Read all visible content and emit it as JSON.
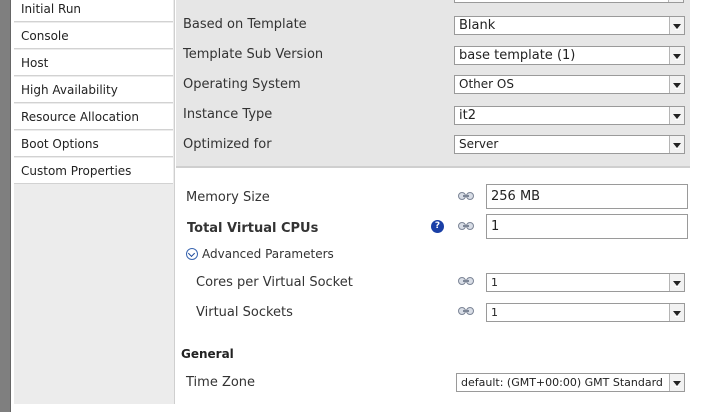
{
  "sidebar": {
    "items": [
      {
        "label": "Initial Run"
      },
      {
        "label": "Console"
      },
      {
        "label": "Host"
      },
      {
        "label": "High Availability"
      },
      {
        "label": "Resource Allocation"
      },
      {
        "label": "Boot Options"
      },
      {
        "label": "Custom Properties"
      }
    ]
  },
  "top_section": {
    "based_on_template": {
      "label": "Based on Template",
      "value": "Blank"
    },
    "template_sub_version": {
      "label": "Template Sub Version",
      "value": "base template (1)"
    },
    "operating_system": {
      "label": "Operating System",
      "value": "Other OS"
    },
    "instance_type": {
      "label": "Instance Type",
      "value": "it2"
    },
    "optimized_for": {
      "label": "Optimized for",
      "value": "Server"
    }
  },
  "system": {
    "memory_size": {
      "label": "Memory Size",
      "value": "256 MB"
    },
    "total_virtual_cpus": {
      "label": "Total Virtual CPUs",
      "value": "1"
    },
    "advanced_parameters": {
      "label": "Advanced Parameters"
    },
    "cores_per_virtual_socket": {
      "label": "Cores per Virtual Socket",
      "value": "1"
    },
    "virtual_sockets": {
      "label": "Virtual Sockets",
      "value": "1"
    }
  },
  "general": {
    "title": "General",
    "time_zone": {
      "label": "Time Zone",
      "value": "default: (GMT+00:00) GMT Standard"
    }
  },
  "icons": {
    "help": "?",
    "link": "link-icon",
    "chevron": "chevron-down-icon"
  }
}
